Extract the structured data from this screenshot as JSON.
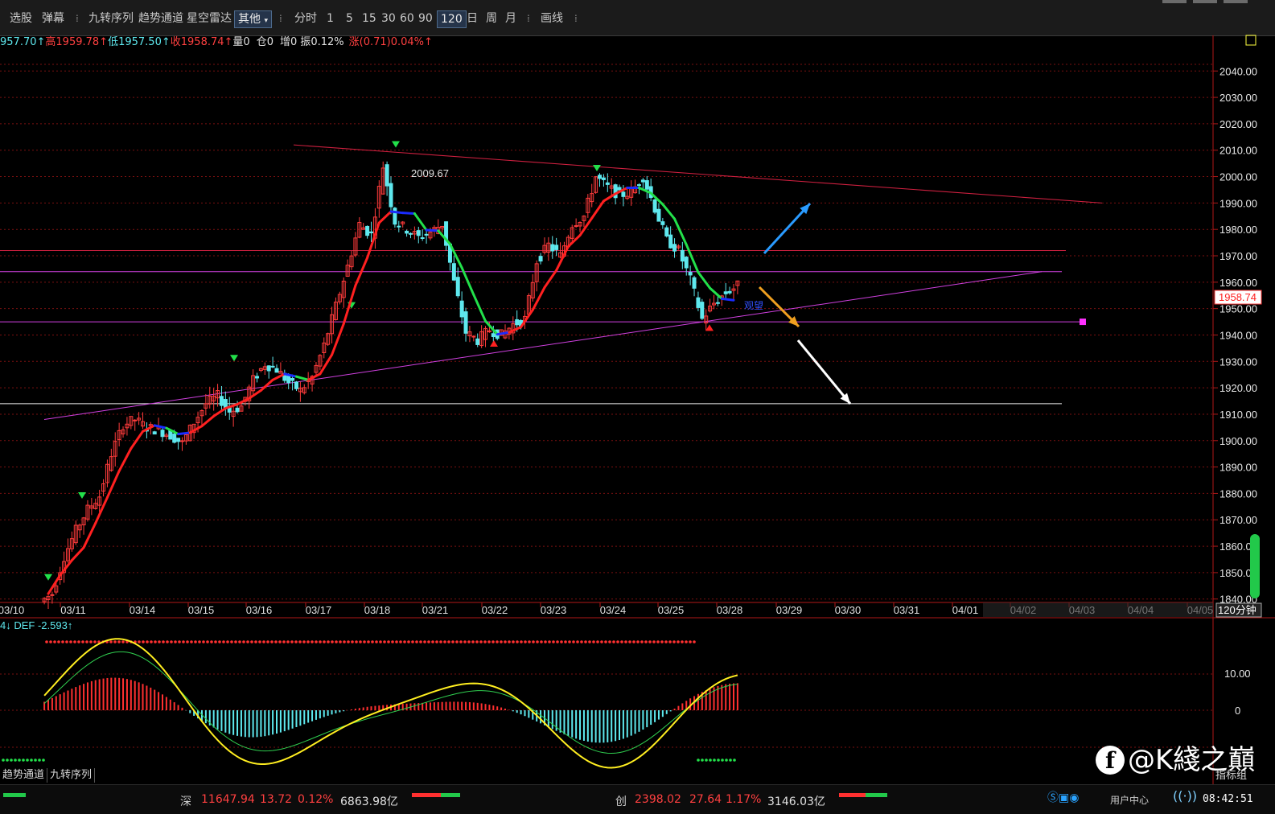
{
  "toolbar": {
    "items": [
      "选股",
      "弹幕",
      "九转序列",
      "趋势通道",
      "星空雷达"
    ],
    "dropdown": "其他",
    "periods": [
      "分时",
      "1",
      "5",
      "15",
      "30",
      "60",
      "90",
      "120",
      "日",
      "周",
      "月"
    ],
    "active_period": "120",
    "draw": "画线",
    "sep": "⁞"
  },
  "quote": {
    "open": "957.70↑",
    "high_label": "高",
    "high": "1959.78↑",
    "low_label": "低",
    "low": "1957.50↑",
    "close_label": "收",
    "close": "1958.74↑",
    "vol_label": "量",
    "vol": "0",
    "oi_label": "仓",
    "oi": "0",
    "inc_label": "增",
    "inc": "0",
    "amp_label": "振",
    "amp": "0.12%",
    "chg_label": "涨",
    "chg": "(0.71)0.04%↑"
  },
  "chart_data": [
    {
      "type": "candlestick",
      "period_label": "120分钟",
      "y_ticks": [
        "2040.00",
        "2030.00",
        "2020.00",
        "2010.00",
        "2000.00",
        "1990.00",
        "1980.00",
        "1970.00",
        "1960.00",
        "1950.00",
        "1940.00",
        "1930.00",
        "1920.00",
        "1910.00",
        "1900.00",
        "1890.00",
        "1880.00",
        "1870.00",
        "1860.00",
        "1850.00",
        "1840.00"
      ],
      "ylim": [
        1839,
        2048
      ],
      "x_ticks": [
        "03/10",
        "03/11",
        "03/14",
        "03/15",
        "03/16",
        "03/17",
        "03/18",
        "03/21",
        "03/22",
        "03/23",
        "03/24",
        "03/25",
        "03/28",
        "03/29",
        "03/30",
        "03/31",
        "04/01",
        "04/02",
        "04/03",
        "04/04",
        "04/05"
      ],
      "annotations": {
        "peak_value": "2009.67",
        "current_price": "1958.74",
        "note": "观望"
      },
      "horizontal_levels": [
        1972,
        1964,
        1945,
        1914
      ],
      "close_path": [
        1842,
        1856,
        1866,
        1874,
        1879,
        1895,
        1906,
        1908,
        1905,
        1904,
        1902,
        1899,
        1907,
        1914,
        1917,
        1911,
        1913,
        1923,
        1929,
        1927,
        1922,
        1919,
        1924,
        1936,
        1951,
        1966,
        1982,
        1978,
        2004,
        1983,
        1980,
        1977,
        1979,
        1982,
        1960,
        1941,
        1938,
        1942,
        1940,
        1944,
        1946,
        1968,
        1974,
        1970,
        1982,
        1985,
        2000,
        1996,
        1993,
        1994,
        2000,
        1988,
        1976,
        1972,
        1961,
        1946,
        1952,
        1956,
        1958.74
      ],
      "trend_segments": "red uptrend / blue flat / green transition"
    },
    {
      "type": "macd",
      "label": "4↓ DEF -2.593↑",
      "y_ticks": [
        "10.00",
        "0"
      ]
    }
  ],
  "tabs": [
    "趋势通道",
    "九转序列"
  ],
  "status": {
    "sh_label": "深",
    "sh_value": "11647.94",
    "sh_chg": "13.72",
    "sh_pct": "0.12%",
    "sh_amt": "6863.98亿",
    "cy_label": "创",
    "cy_value": "2398.02",
    "cy_chg": "27.64",
    "cy_pct": "1.17%",
    "cy_amt": "3146.03亿",
    "user_center": "用户中心",
    "time": "08:42:51",
    "indicator_group": "指标组"
  },
  "watermark": "@K綫之巔",
  "colors": {
    "up": "#ff3b3b",
    "down": "#5ee8ee",
    "grid": "#7a1010",
    "axis": "#b01818"
  }
}
